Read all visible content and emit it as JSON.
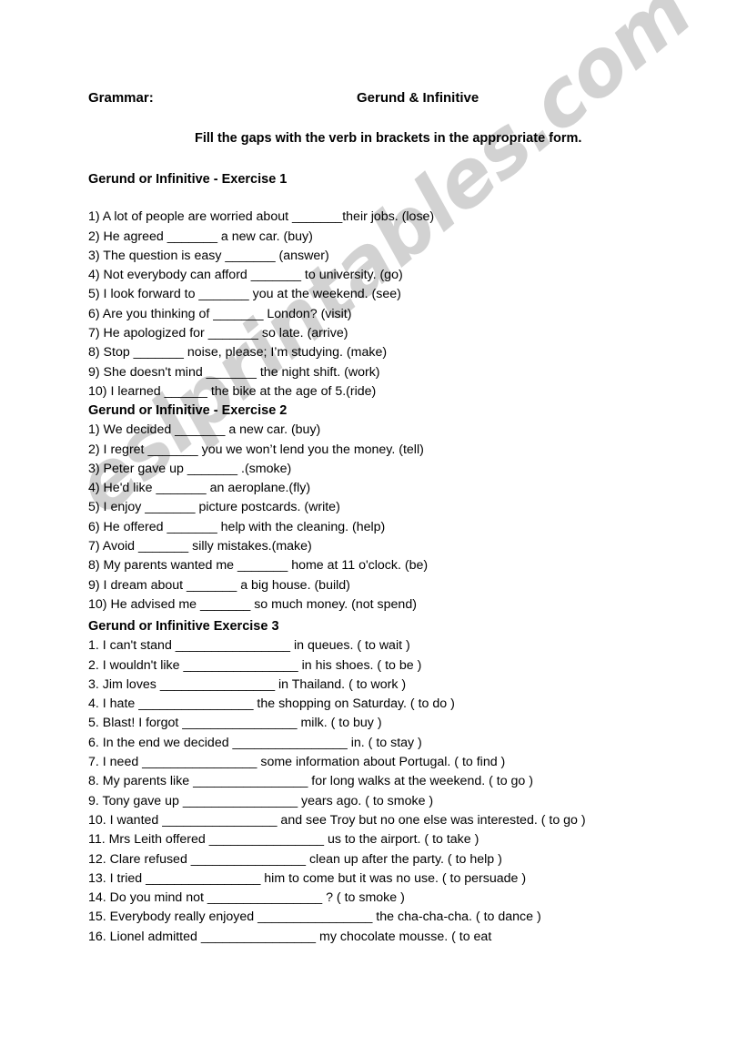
{
  "header": {
    "left_label": "Grammar:",
    "title": "Gerund & Infinitive"
  },
  "instruction": "Fill the gaps with the verb in brackets in the appropriate form.",
  "watermark": {
    "text": "eslprintables.com",
    "color": "#d2d2d2"
  },
  "exercises": [
    {
      "heading": "Gerund or Infinitive - Exercise 1",
      "items": [
        "1) A lot of people are worried about _______their jobs. (lose)",
        "2) He agreed _______  a new car. (buy)",
        "3) The question is easy _______  (answer)",
        " 4) Not everybody can afford _______  to university. (go)",
        "5) I look forward to _______  you at the weekend. (see)",
        " 6) Are you thinking of _______  London? (visit)",
        " 7) He apologized for _______  so late. (arrive)",
        " 8) Stop _______  noise, please; I’m studying. (make)",
        " 9) She doesn't mind _______  the night shift. (work)",
        " 10) I learned ______ the bike at the age of 5.(ride)"
      ]
    },
    {
      "heading": "Gerund or Infinitive - Exercise 2",
      "items": [
        "1) We decided _______  a new car. (buy)",
        "2) I regret _______  you we won’t lend you the money. (tell)",
        "3) Peter gave up _______ .(smoke)",
        "4) He'd like _______  an aeroplane.(fly)",
        " 5) I enjoy _______  picture postcards. (write)",
        "6) He offered _______  help with the cleaning. (help)",
        "7) Avoid _______  silly mistakes.(make)",
        "8) My parents wanted me _______  home at 11 o'clock. (be)",
        "9) I dream about _______  a big house. (build)",
        "10) He advised me _______  so much money. (not spend)"
      ]
    },
    {
      "heading": "Gerund or Infinitive Exercise 3",
      "items": [
        "1. I can't stand ________________ in queues. ( to wait )",
        "2. I wouldn't like ________________ in his shoes. ( to be )",
        "3. Jim loves ________________ in Thailand. ( to work )",
        "4. I hate ________________ the shopping on Saturday. ( to do )",
        "5. Blast! I forgot ________________ milk. ( to buy )",
        "6. In the end we decided ________________ in. ( to stay )",
        "7.  I need ________________ some information about Portugal. ( to find )",
        "8. My parents like ________________ for long walks at the weekend. ( to go )",
        "9. Tony gave up ________________ years ago. ( to smoke )",
        "10. I wanted ________________ and see Troy but no one else was interested. ( to go )",
        "11. Mrs Leith offered ________________ us to the airport. ( to take )",
        "12. Clare refused ________________ clean up after the party. ( to help )",
        "13. I tried ________________ him to come but it was no use. ( to persuade )",
        "14. Do you mind not ________________ ? ( to smoke )",
        "15. Everybody really enjoyed ________________ the cha-cha-cha. ( to dance )",
        "16. Lionel admitted ________________ my chocolate mousse. ( to eat"
      ]
    }
  ]
}
